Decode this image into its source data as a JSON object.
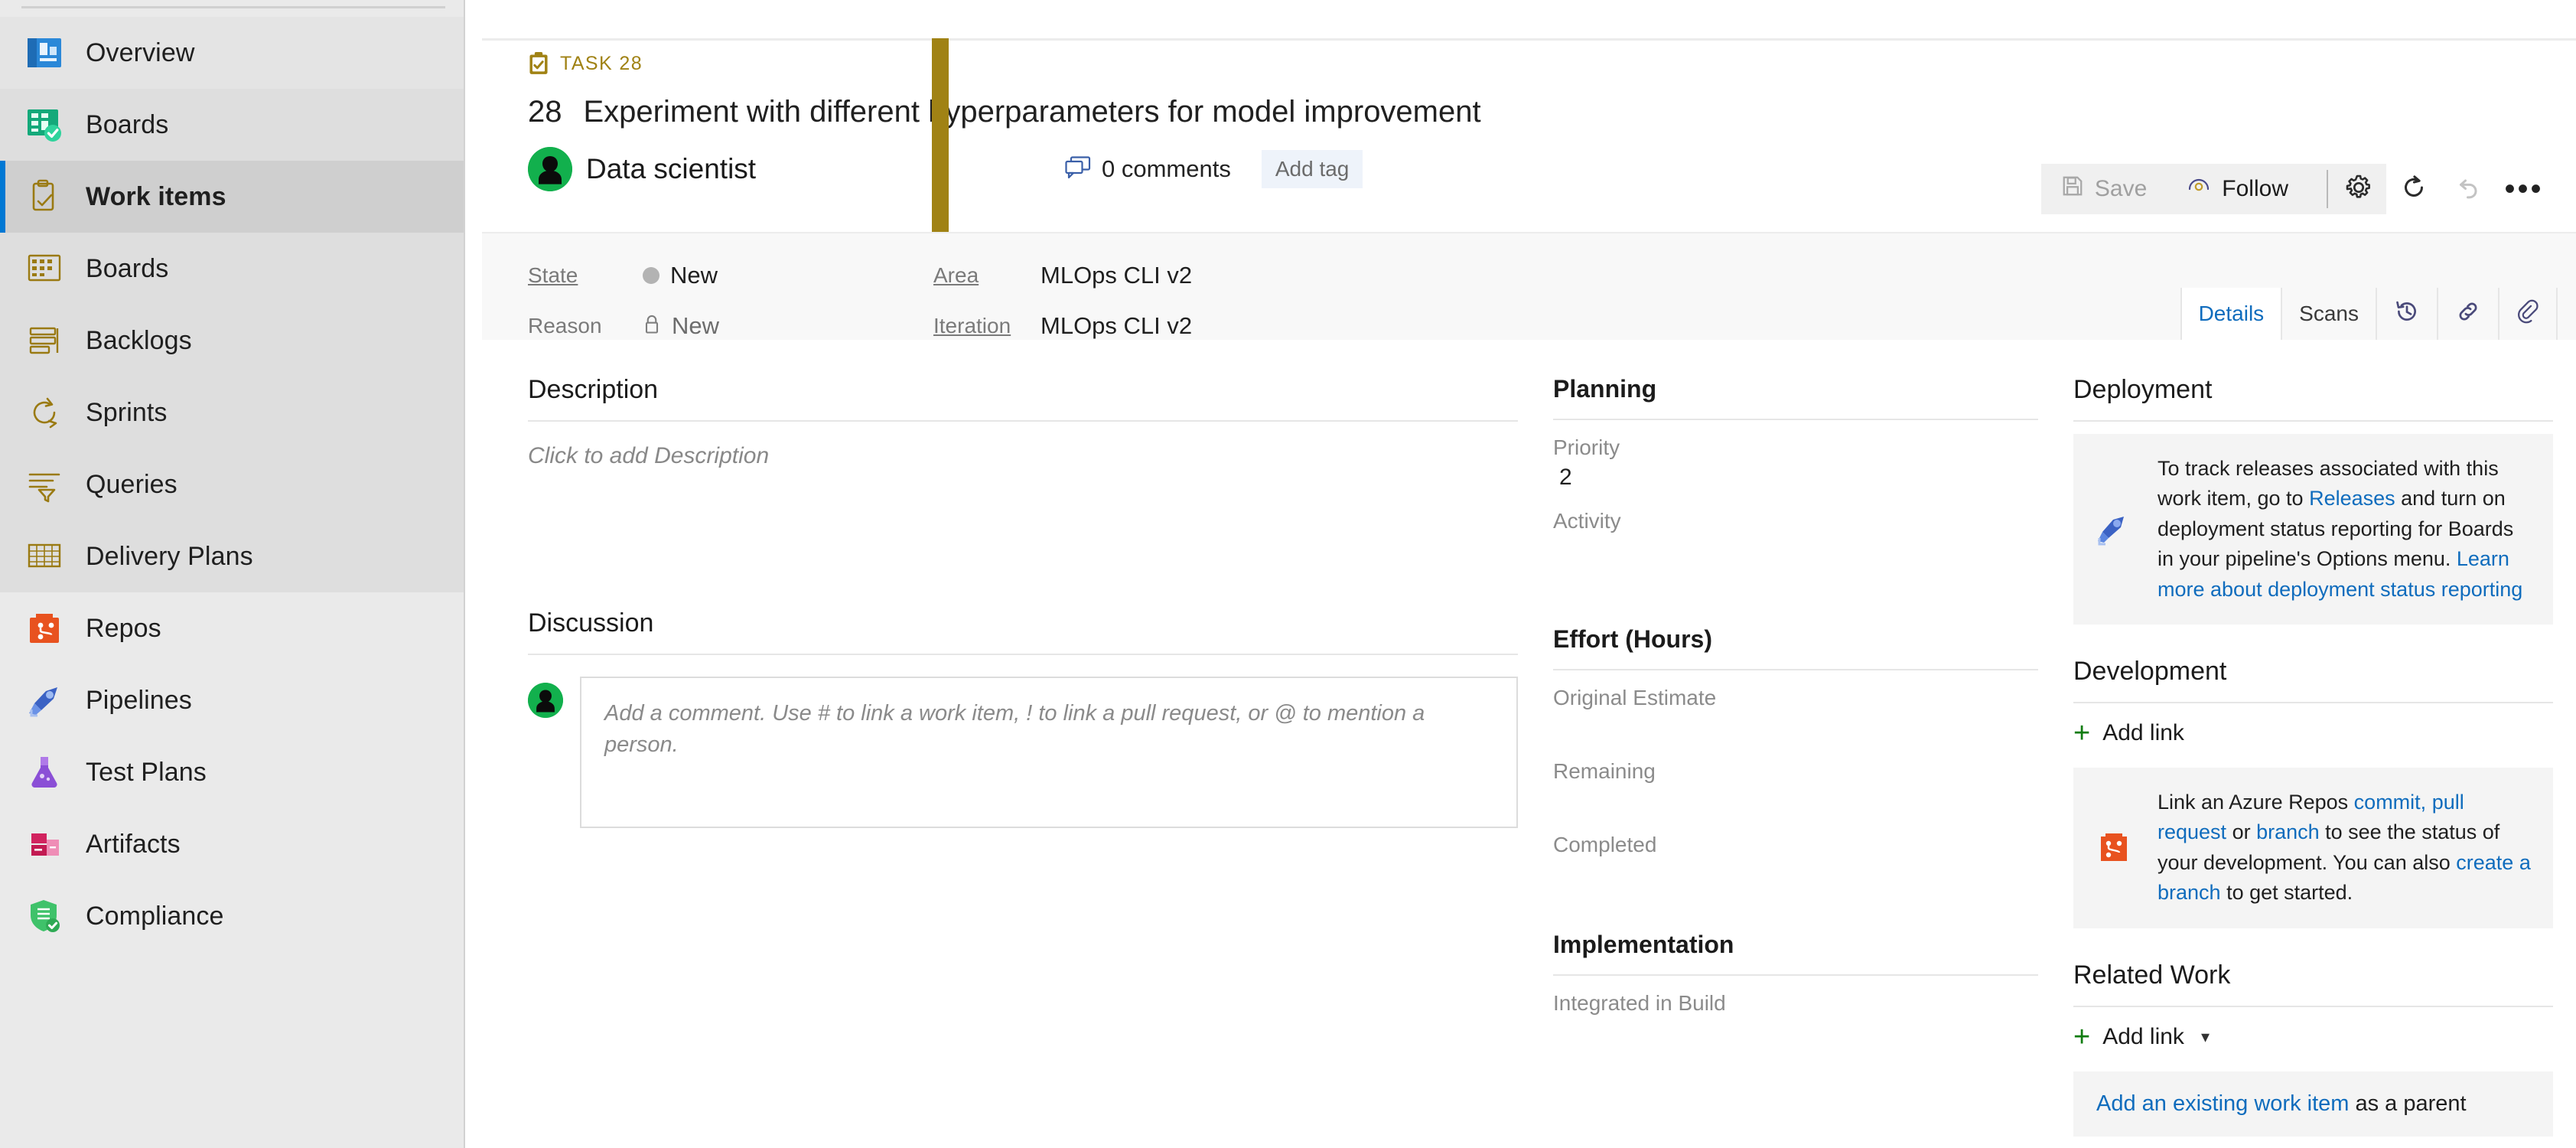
{
  "sidebar": {
    "items": [
      {
        "label": "Overview",
        "icon": "overview-icon",
        "state": "hovered"
      },
      {
        "label": "Boards",
        "icon": "boards-hub-icon",
        "state": "group"
      },
      {
        "label": "Work items",
        "icon": "work-items-icon",
        "state": "selected"
      },
      {
        "label": "Boards",
        "icon": "board-grid-icon",
        "state": "group"
      },
      {
        "label": "Backlogs",
        "icon": "backlogs-icon",
        "state": "group"
      },
      {
        "label": "Sprints",
        "icon": "sprints-icon",
        "state": "group"
      },
      {
        "label": "Queries",
        "icon": "queries-icon",
        "state": "group"
      },
      {
        "label": "Delivery Plans",
        "icon": "delivery-plans-icon",
        "state": "group"
      },
      {
        "label": "Repos",
        "icon": "repos-icon",
        "state": "normal"
      },
      {
        "label": "Pipelines",
        "icon": "pipelines-icon",
        "state": "normal"
      },
      {
        "label": "Test Plans",
        "icon": "test-plans-icon",
        "state": "normal"
      },
      {
        "label": "Artifacts",
        "icon": "artifacts-icon",
        "state": "normal"
      },
      {
        "label": "Compliance",
        "icon": "compliance-icon",
        "state": "normal"
      }
    ]
  },
  "work_item": {
    "type_label": "TASK 28",
    "id": "28",
    "title": "Experiment with different hyperparameters for model improvement",
    "assignee": "Data scientist",
    "comments_label": "0 comments",
    "add_tag_label": "Add tag",
    "accent_color": "#a08214"
  },
  "toolbar": {
    "save_label": "Save",
    "follow_label": "Follow",
    "gear_icon": "gear-icon",
    "refresh_icon": "refresh-icon",
    "undo_icon": "undo-icon",
    "more_icon": "ellipsis-icon"
  },
  "state_bar": {
    "state_label": "State",
    "state_value": "New",
    "reason_label": "Reason",
    "reason_value": "New",
    "area_label": "Area",
    "area_value": "MLOps CLI v2",
    "iteration_label": "Iteration",
    "iteration_value": "MLOps CLI v2"
  },
  "tabs": [
    {
      "label": "Details",
      "icon": "",
      "active": true
    },
    {
      "label": "Scans",
      "icon": "",
      "active": false
    },
    {
      "label": "",
      "icon": "history-icon",
      "active": false
    },
    {
      "label": "",
      "icon": "link-icon",
      "active": false
    },
    {
      "label": "",
      "icon": "attachment-icon",
      "active": false
    }
  ],
  "description": {
    "heading": "Description",
    "placeholder": "Click to add Description"
  },
  "discussion": {
    "heading": "Discussion",
    "placeholder": "Add a comment. Use # to link a work item, ! to link a pull request, or @ to mention a person."
  },
  "planning": {
    "heading": "Planning",
    "fields": [
      {
        "label": "Priority",
        "value": "2"
      },
      {
        "label": "Activity",
        "value": ""
      }
    ]
  },
  "effort": {
    "heading": "Effort (Hours)",
    "fields": [
      {
        "label": "Original Estimate",
        "value": ""
      },
      {
        "label": "Remaining",
        "value": ""
      },
      {
        "label": "Completed",
        "value": ""
      }
    ]
  },
  "implementation": {
    "heading": "Implementation",
    "fields": [
      {
        "label": "Integrated in Build",
        "value": ""
      }
    ]
  },
  "deployment": {
    "heading": "Deployment",
    "info_p1": "To track releases associated with this work item, go to ",
    "info_link1": "Releases",
    "info_p2": " and turn on deployment status reporting for Boards in your pipeline's Options menu. ",
    "info_link2": "Learn more about deployment status reporting"
  },
  "development": {
    "heading": "Development",
    "add_link_label": "Add link",
    "info_p1": "Link an Azure Repos ",
    "info_link_commit": "commit,",
    "info_link_pr": "pull request",
    "info_p2": " or ",
    "info_link_branch": "branch",
    "info_p3": " to see the status of your development. You can also ",
    "info_link_create": "create a branch",
    "info_p4": " to get started."
  },
  "related_work": {
    "heading": "Related Work",
    "add_link_label": "Add link",
    "panel_link": "Add an existing work item",
    "panel_tail": " as a parent"
  }
}
